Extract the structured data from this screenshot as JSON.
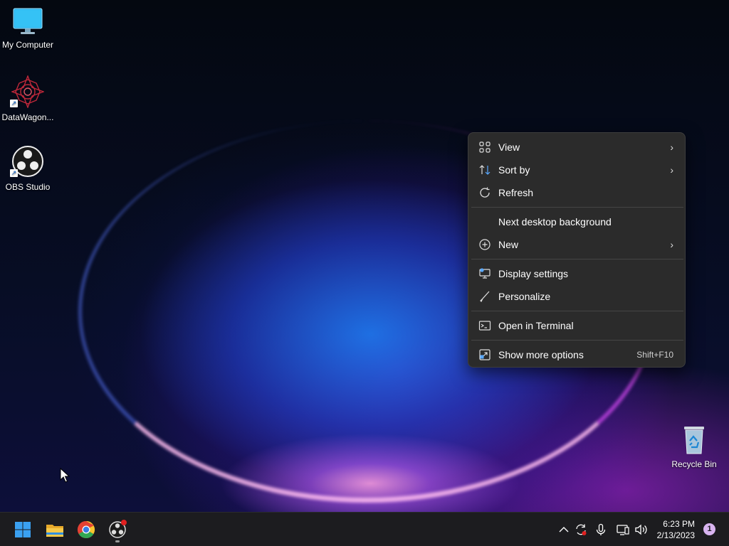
{
  "desktop": {
    "icons": [
      {
        "label": "My Computer",
        "icon": "monitor-icon"
      },
      {
        "label": "DataWagon...",
        "icon": "datawagon-icon"
      },
      {
        "label": "OBS Studio",
        "icon": "obs-icon"
      },
      {
        "label": "Recycle Bin",
        "icon": "recycle-bin-icon"
      }
    ]
  },
  "context_menu": {
    "items": [
      {
        "label": "View",
        "icon": "grid-icon",
        "has_submenu": true
      },
      {
        "label": "Sort by",
        "icon": "sort-icon",
        "has_submenu": true
      },
      {
        "label": "Refresh",
        "icon": "refresh-icon"
      },
      {
        "label": "Next desktop background"
      },
      {
        "label": "New",
        "icon": "plus-circle-icon",
        "has_submenu": true
      },
      {
        "label": "Display settings",
        "icon": "display-settings-icon"
      },
      {
        "label": "Personalize",
        "icon": "brush-icon"
      },
      {
        "label": "Open in Terminal",
        "icon": "terminal-icon"
      },
      {
        "label": "Show more options",
        "icon": "more-options-icon",
        "shortcut": "Shift+F10"
      }
    ]
  },
  "taskbar": {
    "apps": [
      "start-icon",
      "file-explorer-icon",
      "chrome-icon",
      "obs-icon"
    ],
    "tray": [
      "chevron-up-icon",
      "sync-icon",
      "microphone-icon",
      "network-icon",
      "volume-icon"
    ],
    "time": "6:23 PM",
    "date": "2/13/2023",
    "notification_count": "1"
  },
  "colors": {
    "menu_bg": "#2b2b2b",
    "taskbar_bg": "#1c1c1f",
    "accent": "#0a7cd8"
  }
}
